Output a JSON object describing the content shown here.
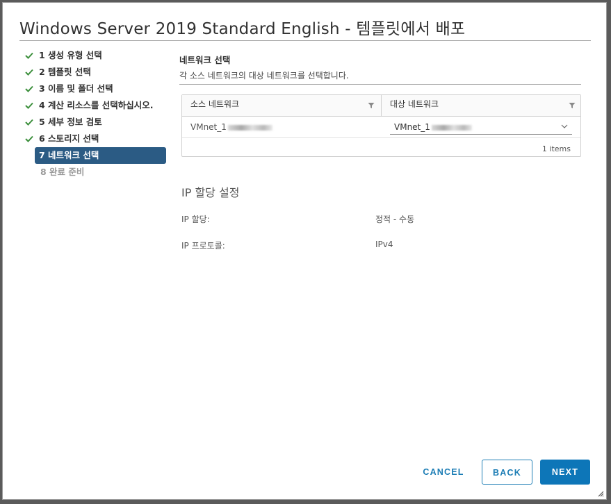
{
  "dialog": {
    "title": "Windows Server 2019 Standard English - 템플릿에서 배포"
  },
  "steps": [
    {
      "label": "1 생성 유형 선택",
      "state": "done"
    },
    {
      "label": "2 템플릿 선택",
      "state": "done"
    },
    {
      "label": "3 이름 및 폴더 선택",
      "state": "done"
    },
    {
      "label": "4 계산 리소스를 선택하십시오.",
      "state": "done"
    },
    {
      "label": "5 세부 정보 검토",
      "state": "done"
    },
    {
      "label": "6 스토리지 선택",
      "state": "done"
    },
    {
      "label": "7 네트워크 선택",
      "state": "active"
    },
    {
      "label": "8 완료 준비",
      "state": "future"
    }
  ],
  "network_section": {
    "title": "네트워크 선택",
    "description": "각 소스 네트워크의 대상 네트워크를 선택합니다."
  },
  "grid": {
    "columns": [
      "소스 네트워크",
      "대상 네트워크"
    ],
    "rows": [
      {
        "source": "VMnet_1",
        "destination": "VMnet_1"
      }
    ],
    "footer": "1 items"
  },
  "ip_settings": {
    "title": "IP 할당 설정",
    "allocation_label": "IP 할당:",
    "allocation_value": "정적 - 수동",
    "protocol_label": "IP 프로토콜:",
    "protocol_value": "IPv4"
  },
  "buttons": {
    "cancel": "CANCEL",
    "back": "BACK",
    "next": "NEXT"
  },
  "colors": {
    "active_step_bg": "#2b5b84",
    "check_green": "#3c8f3c",
    "primary_blue": "#0d76b8"
  },
  "icons": {
    "done_step": "check-icon",
    "column_filter": "filter-icon",
    "select_arrow": "chevron-down-icon",
    "resize": "resize-grip-icon"
  }
}
